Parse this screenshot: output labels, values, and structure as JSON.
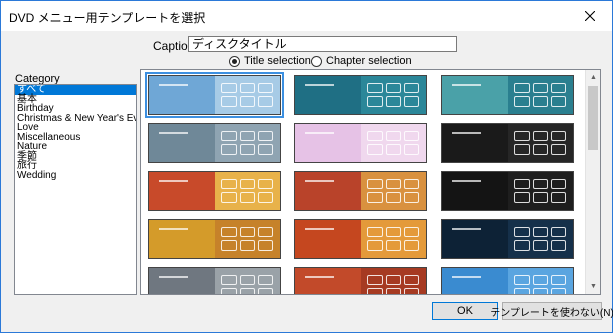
{
  "window": {
    "title": "DVD メニュー用テンプレートを選択"
  },
  "caption": {
    "label": "Caption:",
    "value": "ディスクタイトル"
  },
  "mode": {
    "options": [
      {
        "label": "Title selection",
        "checked": true
      },
      {
        "label": "Chapter selection",
        "checked": false
      }
    ]
  },
  "category": {
    "label": "Category",
    "items": [
      {
        "label": "すべて",
        "selected": true
      },
      {
        "label": "基本",
        "selected": false
      },
      {
        "label": "Birthday",
        "selected": false
      },
      {
        "label": "Christmas & New Year's Eve",
        "selected": false
      },
      {
        "label": "Love",
        "selected": false
      },
      {
        "label": "Miscellaneous",
        "selected": false
      },
      {
        "label": "Nature",
        "selected": false
      },
      {
        "label": "季節",
        "selected": false
      },
      {
        "label": "旅行",
        "selected": false
      },
      {
        "label": "Wedding",
        "selected": false
      }
    ]
  },
  "templates": [
    {
      "name": "template-1",
      "left": "#6fa7d6",
      "right": "#a7cbe6",
      "selected": true
    },
    {
      "name": "template-2",
      "left": "#1f6f84",
      "right": "#2b8799",
      "selected": false
    },
    {
      "name": "template-3",
      "left": "#4aa1a8",
      "right": "#2a7f8f",
      "selected": false
    },
    {
      "name": "template-4",
      "left": "#6f8898",
      "right": "#8fa4b2",
      "selected": false
    },
    {
      "name": "template-5",
      "left": "#e6c2e6",
      "right": "#f0d8ee",
      "selected": false
    },
    {
      "name": "template-6",
      "left": "#1a1a1a",
      "right": "#262626",
      "selected": false
    },
    {
      "name": "template-7",
      "left": "#c84a2a",
      "right": "#e8b24a",
      "selected": false
    },
    {
      "name": "template-8",
      "left": "#b9432a",
      "right": "#d9913f",
      "selected": false
    },
    {
      "name": "template-9",
      "left": "#141414",
      "right": "#1e1e1e",
      "selected": false
    },
    {
      "name": "template-10",
      "left": "#d49b2a",
      "right": "#c6822a",
      "selected": false
    },
    {
      "name": "template-11",
      "left": "#c5471f",
      "right": "#e49a3a",
      "selected": false
    },
    {
      "name": "template-12",
      "left": "#0d2236",
      "right": "#15304a",
      "selected": false
    },
    {
      "name": "template-13",
      "left": "#6f7780",
      "right": "#9aa2a8",
      "selected": false
    },
    {
      "name": "template-14",
      "left": "#c24a2a",
      "right": "#a63a22",
      "selected": false
    },
    {
      "name": "template-15",
      "left": "#3a8bd0",
      "right": "#5aa5e0",
      "selected": false
    }
  ],
  "buttons": {
    "ok": "OK",
    "no_template": "テンプレートを使わない(N)"
  }
}
